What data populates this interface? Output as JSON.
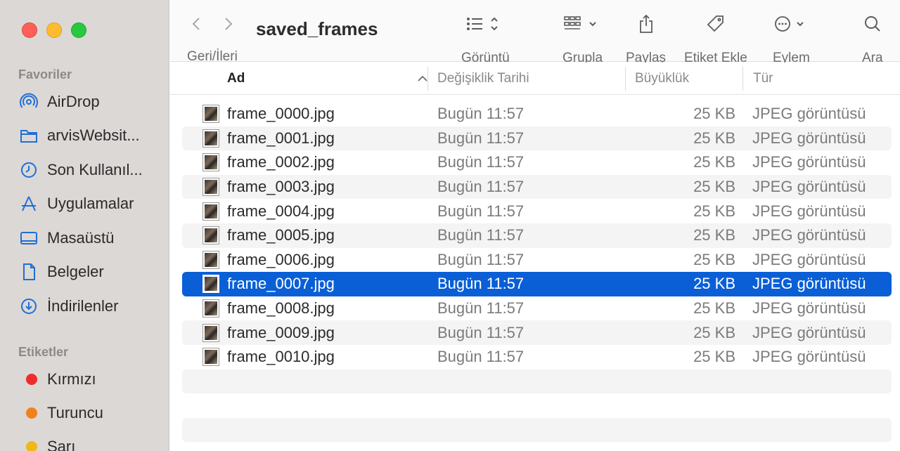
{
  "window": {
    "title": "saved_frames"
  },
  "sidebar": {
    "favorites_heading": "Favoriler",
    "favorites": [
      {
        "label": "AirDrop",
        "icon": "airdrop-icon"
      },
      {
        "label": "arvisWebsit...",
        "icon": "folder-icon"
      },
      {
        "label": "Son Kullanıl...",
        "icon": "clock-icon"
      },
      {
        "label": "Uygulamalar",
        "icon": "applications-icon"
      },
      {
        "label": "Masaüstü",
        "icon": "desktop-icon"
      },
      {
        "label": "Belgeler",
        "icon": "document-icon"
      },
      {
        "label": "İndirilenler",
        "icon": "download-icon"
      }
    ],
    "tags_heading": "Etiketler",
    "tags": [
      {
        "label": "Kırmızı",
        "color": "#ef2c2c"
      },
      {
        "label": "Turuncu",
        "color": "#f0821c"
      },
      {
        "label": "Sarı",
        "color": "#efb81a"
      }
    ],
    "accent": "#1f6fd6"
  },
  "toolbar": {
    "nav_label": "Geri/İleri",
    "view_label": "Görüntü",
    "group_label": "Grupla",
    "share_label": "Paylaş",
    "tag_label": "Etiket Ekle",
    "action_label": "Eylem",
    "search_label": "Ara"
  },
  "columns": {
    "name": "Ad",
    "date": "Değişiklik Tarihi",
    "size": "Büyüklük",
    "kind": "Tür"
  },
  "files": [
    {
      "name": "frame_0000.jpg",
      "date": "Bugün 11:57",
      "size": "25 KB",
      "kind": "JPEG görüntüsü"
    },
    {
      "name": "frame_0001.jpg",
      "date": "Bugün 11:57",
      "size": "25 KB",
      "kind": "JPEG görüntüsü"
    },
    {
      "name": "frame_0002.jpg",
      "date": "Bugün 11:57",
      "size": "25 KB",
      "kind": "JPEG görüntüsü"
    },
    {
      "name": "frame_0003.jpg",
      "date": "Bugün 11:57",
      "size": "25 KB",
      "kind": "JPEG görüntüsü"
    },
    {
      "name": "frame_0004.jpg",
      "date": "Bugün 11:57",
      "size": "25 KB",
      "kind": "JPEG görüntüsü"
    },
    {
      "name": "frame_0005.jpg",
      "date": "Bugün 11:57",
      "size": "25 KB",
      "kind": "JPEG görüntüsü"
    },
    {
      "name": "frame_0006.jpg",
      "date": "Bugün 11:57",
      "size": "25 KB",
      "kind": "JPEG görüntüsü"
    },
    {
      "name": "frame_0007.jpg",
      "date": "Bugün 11:57",
      "size": "25 KB",
      "kind": "JPEG görüntüsü",
      "selected": true
    },
    {
      "name": "frame_0008.jpg",
      "date": "Bugün 11:57",
      "size": "25 KB",
      "kind": "JPEG görüntüsü"
    },
    {
      "name": "frame_0009.jpg",
      "date": "Bugün 11:57",
      "size": "25 KB",
      "kind": "JPEG görüntüsü"
    },
    {
      "name": "frame_0010.jpg",
      "date": "Bugün 11:57",
      "size": "25 KB",
      "kind": "JPEG görüntüsü"
    }
  ]
}
